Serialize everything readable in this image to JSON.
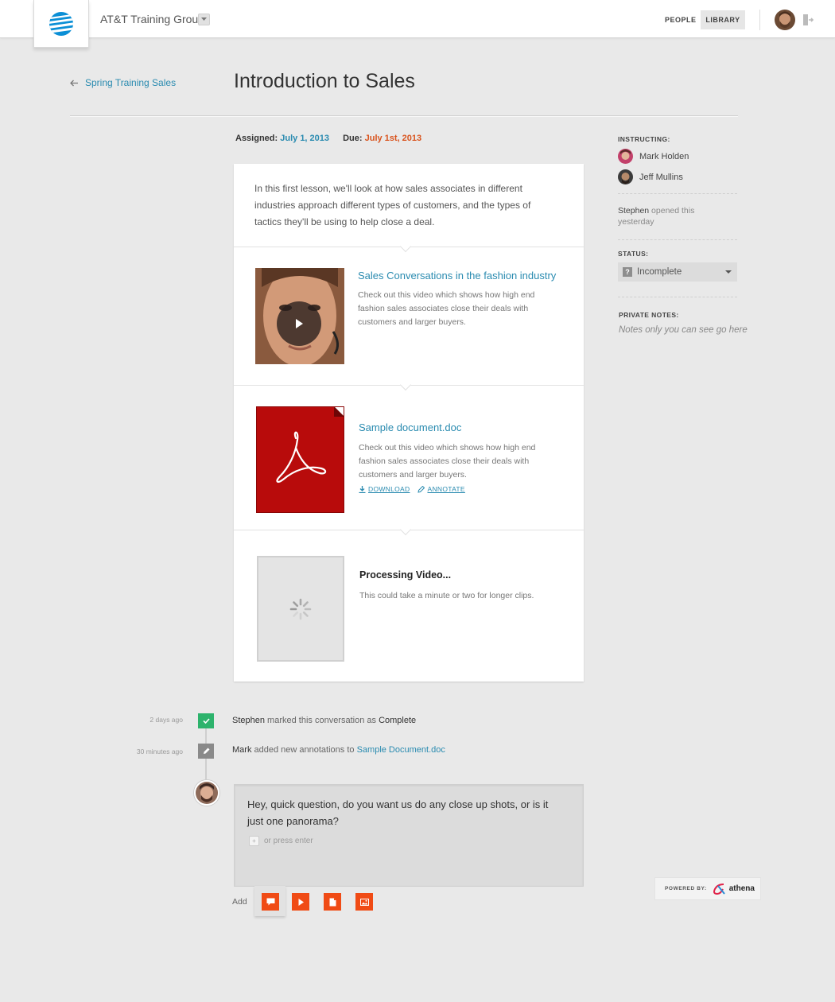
{
  "header": {
    "org_name": "AT&T Training Group",
    "nav": {
      "people": "PEOPLE",
      "library": "LIBRARY"
    }
  },
  "page": {
    "back_label": "Spring Training Sales",
    "title": "Introduction to Sales",
    "assigned_label": "Assigned:",
    "assigned_date": "July 1, 2013",
    "due_label": "Due:",
    "due_date": "July 1st, 2013"
  },
  "lesson": {
    "intro": "In this first lesson, we'll look at how sales associates in different industries approach different types of customers, and the types of tactics they'll be using to help close a deal.",
    "items": [
      {
        "type": "video",
        "title": "Sales Conversations in the fashion industry",
        "description": "Check out this video which shows how high end fashion sales associates close their deals with customers and larger buyers."
      },
      {
        "type": "document",
        "title": "Sample document.doc",
        "description": "Check out this video which shows how high end fashion sales associates close their deals with customers and larger buyers.",
        "download_label": "DOWNLOAD",
        "annotate_label": "ANNOTATE"
      },
      {
        "type": "processing",
        "title": "Processing Video...",
        "description": "This could take a minute or two for longer clips."
      }
    ]
  },
  "sidebar": {
    "instructing_label": "INSTRUCTING:",
    "instructors": [
      {
        "name": "Mark Holden"
      },
      {
        "name": "Jeff Mullins"
      }
    ],
    "activity_actor": "Stephen",
    "activity_text": "opened this yesterday",
    "status_label": "STATUS:",
    "status_value": "Incomplete",
    "status_icon": "?",
    "notes_label": "PRIVATE NOTES:",
    "notes_placeholder": "Notes only you can see go here"
  },
  "timeline": [
    {
      "time": "2 days ago",
      "actor": "Stephen",
      "action": "marked this conversation as",
      "object": "Complete",
      "icon": "check-icon",
      "color": "#2db36c"
    },
    {
      "time": "30 minutes ago",
      "actor": "Mark",
      "action": "added new annotations to",
      "object": "Sample Document.doc",
      "icon": "pencil-icon",
      "color": "#8a8a8a"
    }
  ],
  "comment": {
    "text": "Hey, quick question, do you want us do any close up shots, or is it just one panorama?",
    "enter_hint": "or press enter",
    "enter_key": "+"
  },
  "add_bar": {
    "label": "Add",
    "buttons": [
      "comment-icon",
      "video-icon",
      "document-icon",
      "image-icon"
    ],
    "color": "#f04b15"
  },
  "powered": {
    "label": "POWERED BY:",
    "brand": "athena"
  },
  "colors": {
    "link": "#2a8bb0",
    "due": "#d9541e",
    "accent": "#f04b15",
    "pdf": "#b30b0b"
  }
}
